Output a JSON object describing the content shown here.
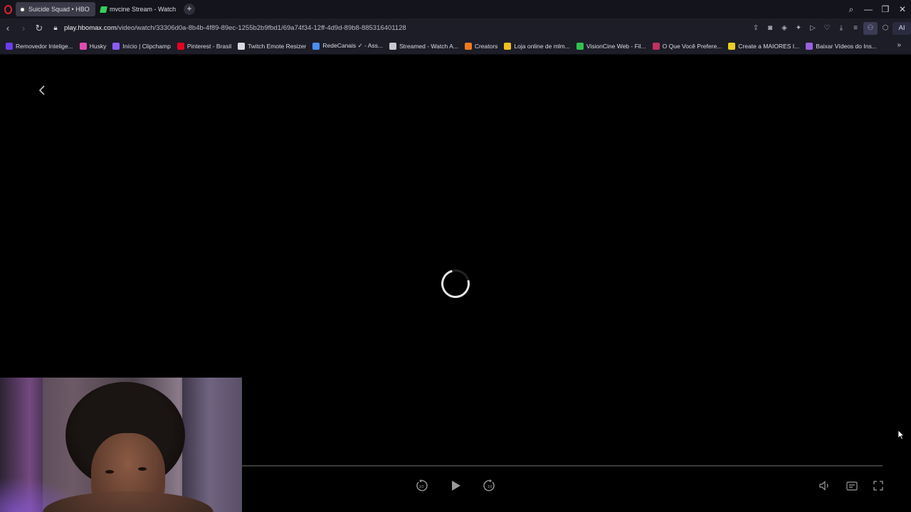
{
  "browser": {
    "tabs": [
      {
        "title": "Suicide Squad • HBO Max",
        "active": true
      },
      {
        "title": "mvcine Stream - Watch Li",
        "active": false
      }
    ],
    "new_tab_label": "+",
    "address": {
      "host": "play.hbomax.com",
      "path": "/video/watch/33306d0a-8b4b-4f89-89ec-1255b2b9fbd1/69a74f34-12ff-4d9d-89b8-885316401128"
    },
    "ai_label": "AI",
    "bookmarks": [
      {
        "label": "Removedor Intelige...",
        "color": "#6b3cf0"
      },
      {
        "label": "Husky",
        "color": "#e04bb0"
      },
      {
        "label": "Início | Clipchamp",
        "color": "#8a5cf6"
      },
      {
        "label": "Pinterest - Brasil",
        "color": "#e60023"
      },
      {
        "label": "Twitch Emote Resizer",
        "color": "#d9d9e0"
      },
      {
        "label": "RedeCanais ✓ - Ass...",
        "color": "#4a8ef0"
      },
      {
        "label": "Streamed - Watch A...",
        "color": "#c8c8d0"
      },
      {
        "label": "Creators",
        "color": "#f07a20"
      },
      {
        "label": "Loja online de mlm...",
        "color": "#f0c020"
      },
      {
        "label": "VisionCine Web - Fil...",
        "color": "#30c050"
      },
      {
        "label": "O Que Você Prefere...",
        "color": "#c03060"
      },
      {
        "label": "Create a MAIORES I...",
        "color": "#e8d020"
      },
      {
        "label": "Baixar Vídeos do Ins...",
        "color": "#9a60e0"
      }
    ]
  },
  "player": {
    "state": "loading",
    "progress_fraction": 0.0,
    "icons": {
      "back": "chevron-left-icon",
      "rewind": "rewind-10-icon",
      "play": "play-icon",
      "forward": "forward-10-icon",
      "volume": "volume-icon",
      "subtitles": "subtitles-icon",
      "fullscreen": "fullscreen-icon"
    }
  },
  "colors": {
    "accent": "#e0222c",
    "player_bg": "#000000",
    "chrome_bg": "#1d1d28"
  }
}
